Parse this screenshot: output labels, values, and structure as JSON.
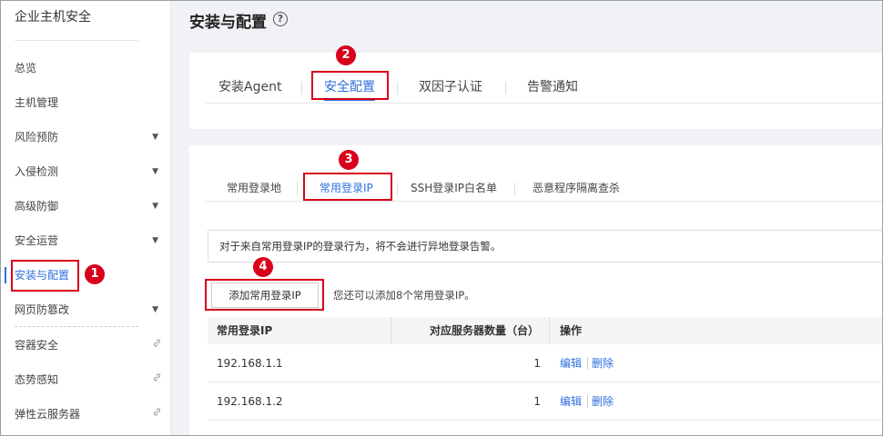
{
  "sidebar": {
    "title": "企业主机安全",
    "items": [
      {
        "label": "总览",
        "suffix": ""
      },
      {
        "label": "主机管理",
        "suffix": ""
      },
      {
        "label": "风险预防",
        "suffix": "▼"
      },
      {
        "label": "入侵检测",
        "suffix": "▼"
      },
      {
        "label": "高级防御",
        "suffix": "▼"
      },
      {
        "label": "安全运营",
        "suffix": "▼"
      },
      {
        "label": "安装与配置",
        "suffix": ""
      },
      {
        "label": "网页防篡改",
        "suffix": "▼"
      },
      {
        "label": "容器安全",
        "suffix": "link"
      },
      {
        "label": "态势感知",
        "suffix": "link"
      },
      {
        "label": "弹性云服务器",
        "suffix": "link"
      }
    ]
  },
  "header": {
    "title": "安装与配置",
    "help_icon": "?"
  },
  "tabs1": [
    "安装Agent",
    "安全配置",
    "双因子认证",
    "告警通知"
  ],
  "tabs2": [
    "常用登录地",
    "常用登录IP",
    "SSH登录IP白名单",
    "恶意程序隔离查杀"
  ],
  "notice": "对于来自常用登录IP的登录行为，将不会进行异地登录告警。",
  "add_button": "添加常用登录IP",
  "hint": "您还可以添加8个常用登录IP。",
  "table": {
    "headers": [
      "常用登录IP",
      "对应服务器数量（台）",
      "操作"
    ],
    "rows": [
      {
        "ip": "192.168.1.1",
        "count": "1",
        "edit": "编辑",
        "delete": "删除"
      },
      {
        "ip": "192.168.1.2",
        "count": "1",
        "edit": "编辑",
        "delete": "删除"
      }
    ]
  },
  "badges": [
    "1",
    "2",
    "3",
    "4"
  ],
  "colors": {
    "accent": "#2f6fdf",
    "highlight": "#d9001b"
  },
  "icons": {
    "link": "🔗",
    "caret": "▼"
  }
}
